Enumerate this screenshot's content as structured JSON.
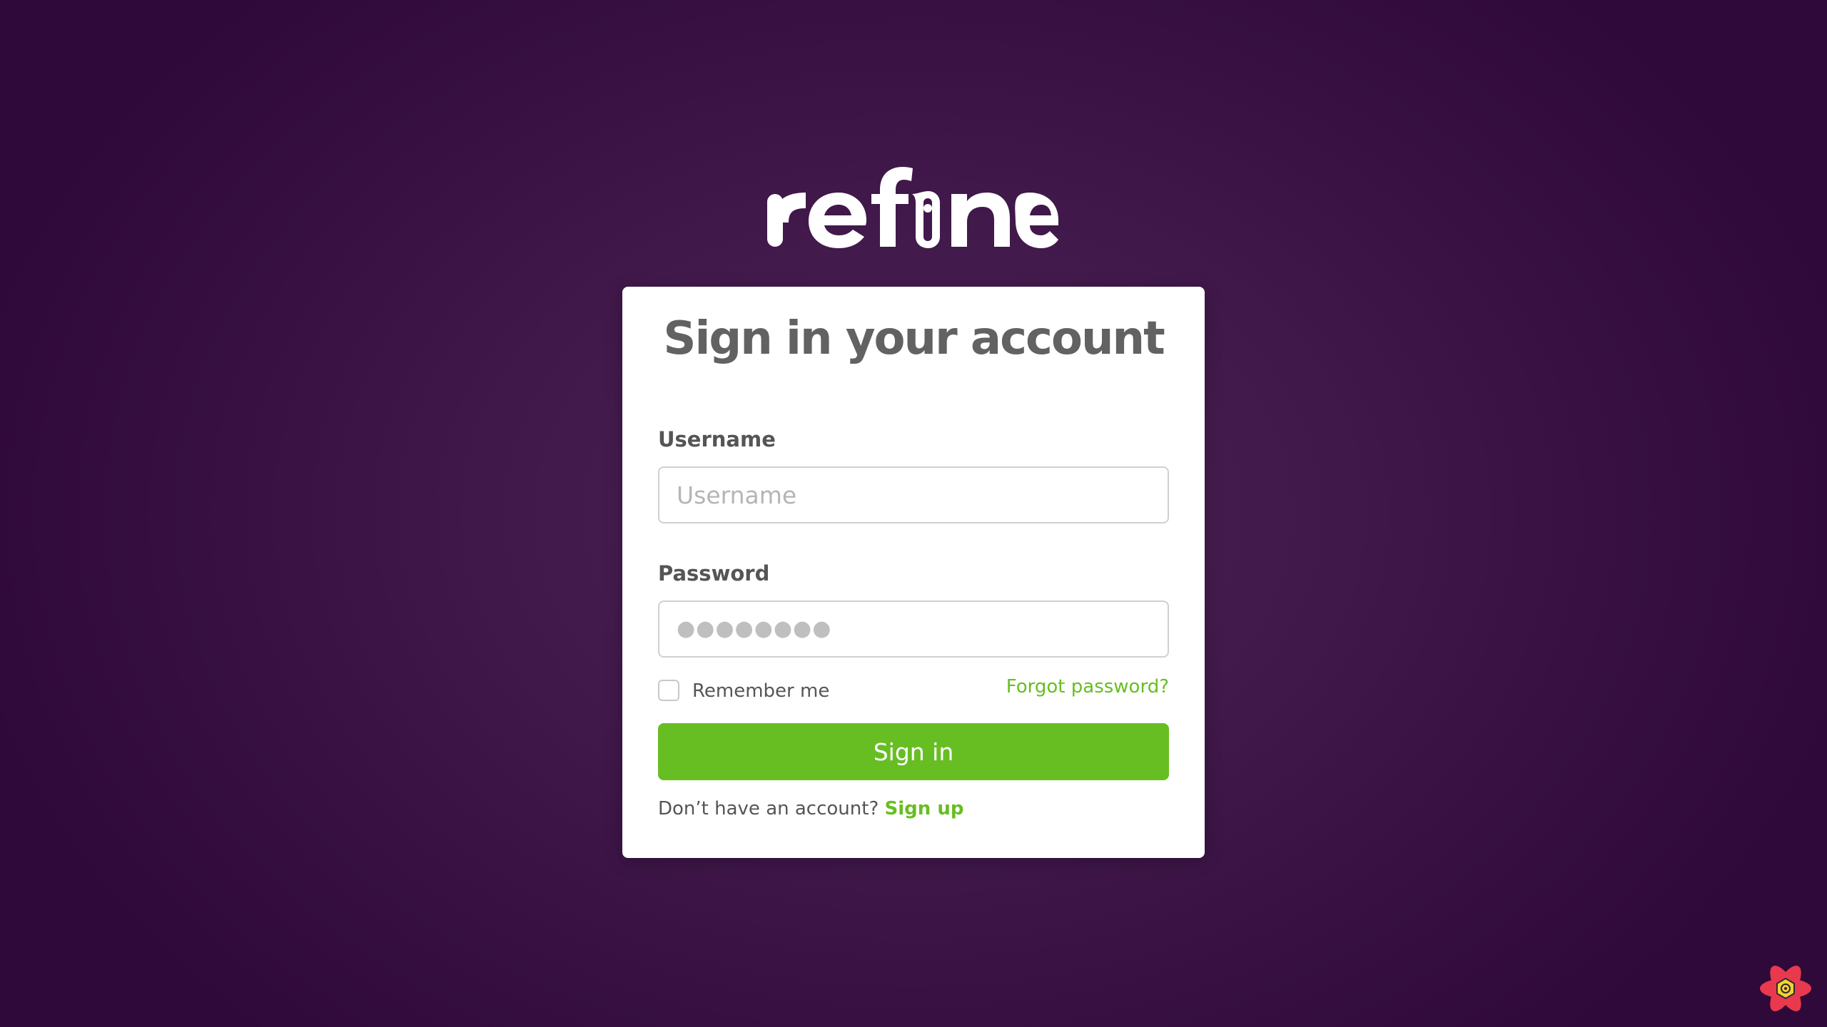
{
  "brand": {
    "logo_text": "refine",
    "accent_color": "#67be23"
  },
  "card": {
    "title": "Sign in your account"
  },
  "form": {
    "username_label": "Username",
    "username_placeholder": "Username",
    "username_value": "",
    "password_label": "Password",
    "password_value_masked": "●●●●●●●●",
    "remember_label": "Remember me",
    "remember_checked": false,
    "forgot_link": "Forgot password?",
    "submit_label": "Sign in"
  },
  "footer": {
    "no_account_text": "Don’t have an account?",
    "signup_link": "Sign up"
  },
  "devtools": {
    "icon": "refine-devtools-icon"
  }
}
